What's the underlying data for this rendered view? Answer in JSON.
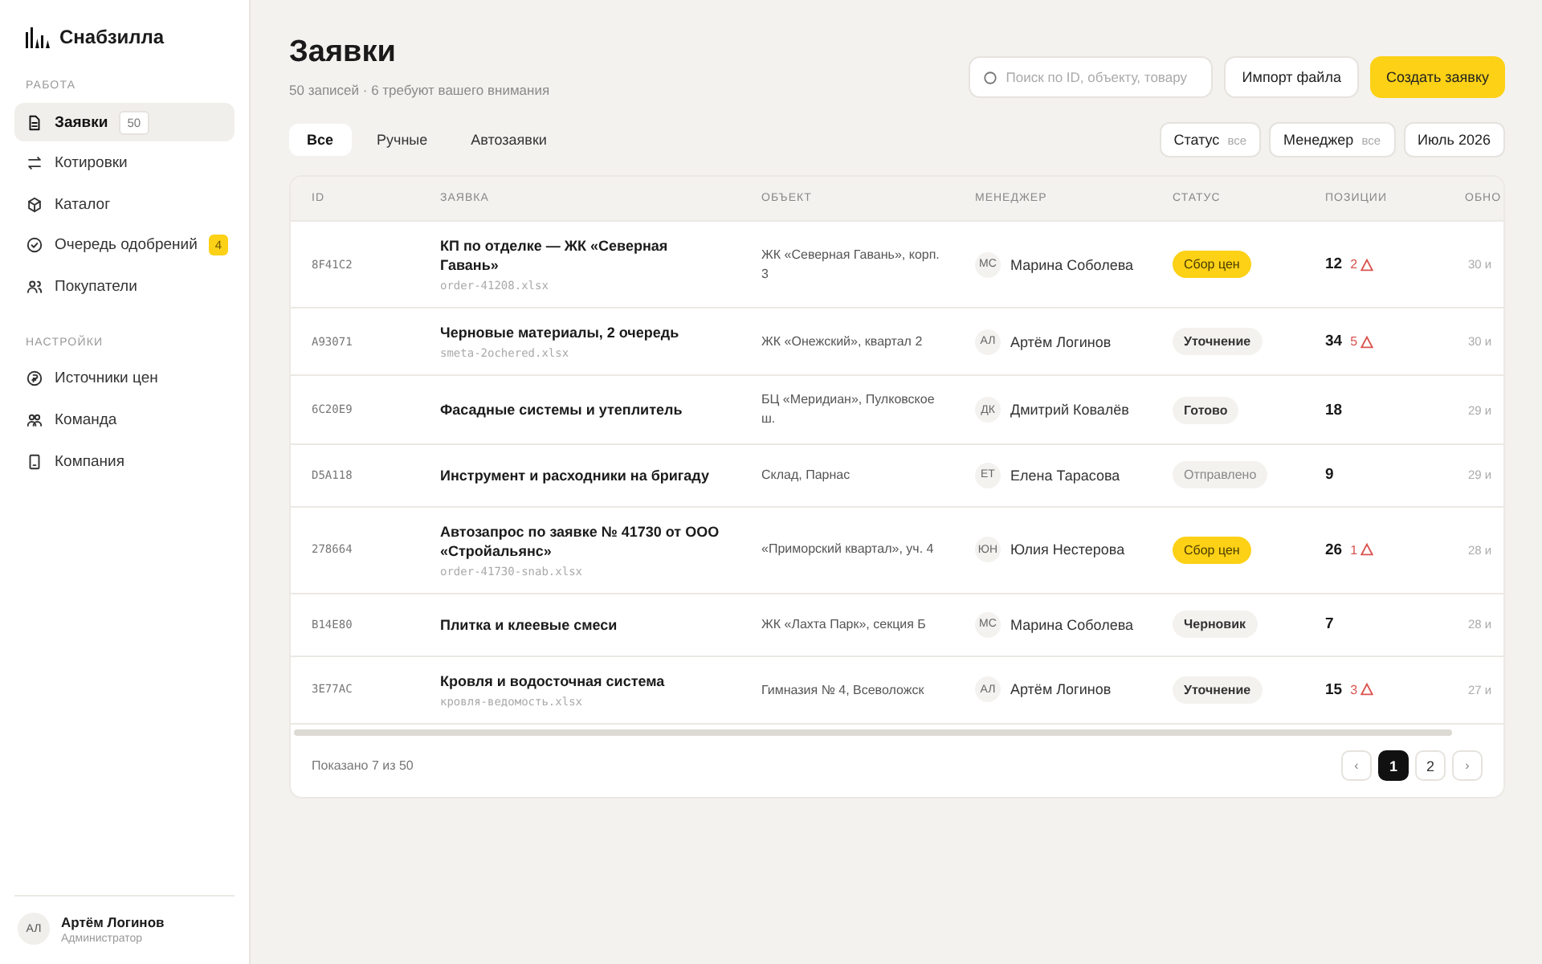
{
  "sidebar": {
    "brand": "Снабзилла",
    "sections": [
      {
        "title": "РАБОТА",
        "items": [
          {
            "label": "Заявки",
            "selected": true,
            "badge": {
              "text": "50",
              "kind": "neutral"
            }
          },
          {
            "label": "Котировки",
            "selected": false
          },
          {
            "label": "Каталог",
            "selected": false
          },
          {
            "label": "Очередь одобрений",
            "selected": false,
            "badge": {
              "text": "4",
              "kind": "accent"
            }
          },
          {
            "label": "Покупатели",
            "selected": false
          }
        ]
      },
      {
        "title": "НАСТРОЙКИ",
        "items": [
          {
            "label": "Источники цен",
            "selected": false
          },
          {
            "label": "Команда",
            "selected": false
          },
          {
            "label": "Компания",
            "selected": false
          }
        ]
      }
    ],
    "user": {
      "initials": "АЛ",
      "name": "Артём Логинов",
      "role": "Администратор"
    }
  },
  "header": {
    "title": "Заявки",
    "subtitle": "50 записей · 6 требуют вашего внимания",
    "search": {
      "placeholder": "Поиск по ID, объекту, товару"
    },
    "buttons": [
      {
        "label": "Импорт файла",
        "kind": "secondary"
      },
      {
        "label": "Создать заявку",
        "kind": "primary"
      }
    ]
  },
  "tabs": [
    {
      "label": "Все",
      "selected": true
    },
    {
      "label": "Ручные",
      "selected": false
    },
    {
      "label": "Автозаявки",
      "selected": false
    }
  ],
  "filters": [
    {
      "label": "Статус",
      "value": "все"
    },
    {
      "label": "Менеджер",
      "value": "все"
    },
    {
      "label": "Июль 2026"
    }
  ],
  "table": {
    "columns": [
      "ID",
      "ЗАЯВКА",
      "ОБЪЕКТ",
      "МЕНЕДЖЕР",
      "СТАТУС",
      "ПОЗИЦИИ",
      "ОБНО"
    ],
    "rows": [
      {
        "id": "8F41C2",
        "title": "КП по отделке — ЖК «Северная Гавань»",
        "file": "order-41208.xlsx",
        "object": "ЖК «Северная Гавань», корп. 3",
        "manager": {
          "initials": "МС",
          "name": "Марина Соболева"
        },
        "status": {
          "label": "Сбор цен",
          "kind": "accent"
        },
        "positions": "12",
        "warnings": "2",
        "updated": "30 и"
      },
      {
        "id": "A93071",
        "title": "Черновые материалы, 2 очередь",
        "file": "smeta-2ochered.xlsx",
        "object": "ЖК «Онежский», квартал 2",
        "manager": {
          "initials": "АЛ",
          "name": "Артём Логинов"
        },
        "status": {
          "label": "Уточнение",
          "kind": "neutral"
        },
        "positions": "34",
        "warnings": "5",
        "updated": "30 и"
      },
      {
        "id": "6C20E9",
        "title": "Фасадные системы и утеплитель",
        "object": "БЦ «Меридиан», Пулковское ш.",
        "manager": {
          "initials": "ДК",
          "name": "Дмитрий Ковалёв"
        },
        "status": {
          "label": "Готово",
          "kind": "neutral"
        },
        "positions": "18",
        "updated": "29 и"
      },
      {
        "id": "D5A118",
        "title": "Инструмент и расходники на бригаду",
        "object": "Склад, Парнас",
        "manager": {
          "initials": "ЕТ",
          "name": "Елена Тарасова"
        },
        "status": {
          "label": "Отправлено",
          "kind": "muted"
        },
        "positions": "9",
        "updated": "29 и"
      },
      {
        "id": "278664",
        "title": "Автозапрос по заявке № 41730 от ООО «Стройальянс»",
        "file": "order-41730-snab.xlsx",
        "object": "«Приморский квартал», уч. 4",
        "manager": {
          "initials": "ЮН",
          "name": "Юлия Нестерова"
        },
        "status": {
          "label": "Сбор цен",
          "kind": "accent"
        },
        "positions": "26",
        "warnings": "1",
        "updated": "28 и"
      },
      {
        "id": "B14E80",
        "title": "Плитка и клеевые смеси",
        "object": "ЖК «Лахта Парк», секция Б",
        "manager": {
          "initials": "МС",
          "name": "Марина Соболева"
        },
        "status": {
          "label": "Черновик",
          "kind": "neutral"
        },
        "positions": "7",
        "updated": "28 и"
      },
      {
        "id": "3E77AC",
        "title": "Кровля и водосточная система",
        "file": "кровля-ведомость.xlsx",
        "object": "Гимназия № 4, Всеволожск",
        "manager": {
          "initials": "АЛ",
          "name": "Артём Логинов"
        },
        "status": {
          "label": "Уточнение",
          "kind": "neutral"
        },
        "positions": "15",
        "warnings": "3",
        "updated": "27 и"
      }
    ]
  },
  "footer": {
    "summary": "Показано 7 из 50",
    "pages": [
      {
        "label": "‹",
        "kind": "arrow",
        "selected": false
      },
      {
        "label": "1",
        "kind": "page",
        "selected": true
      },
      {
        "label": "2",
        "kind": "page",
        "selected": false
      },
      {
        "label": "›",
        "kind": "arrow",
        "selected": false
      }
    ]
  }
}
